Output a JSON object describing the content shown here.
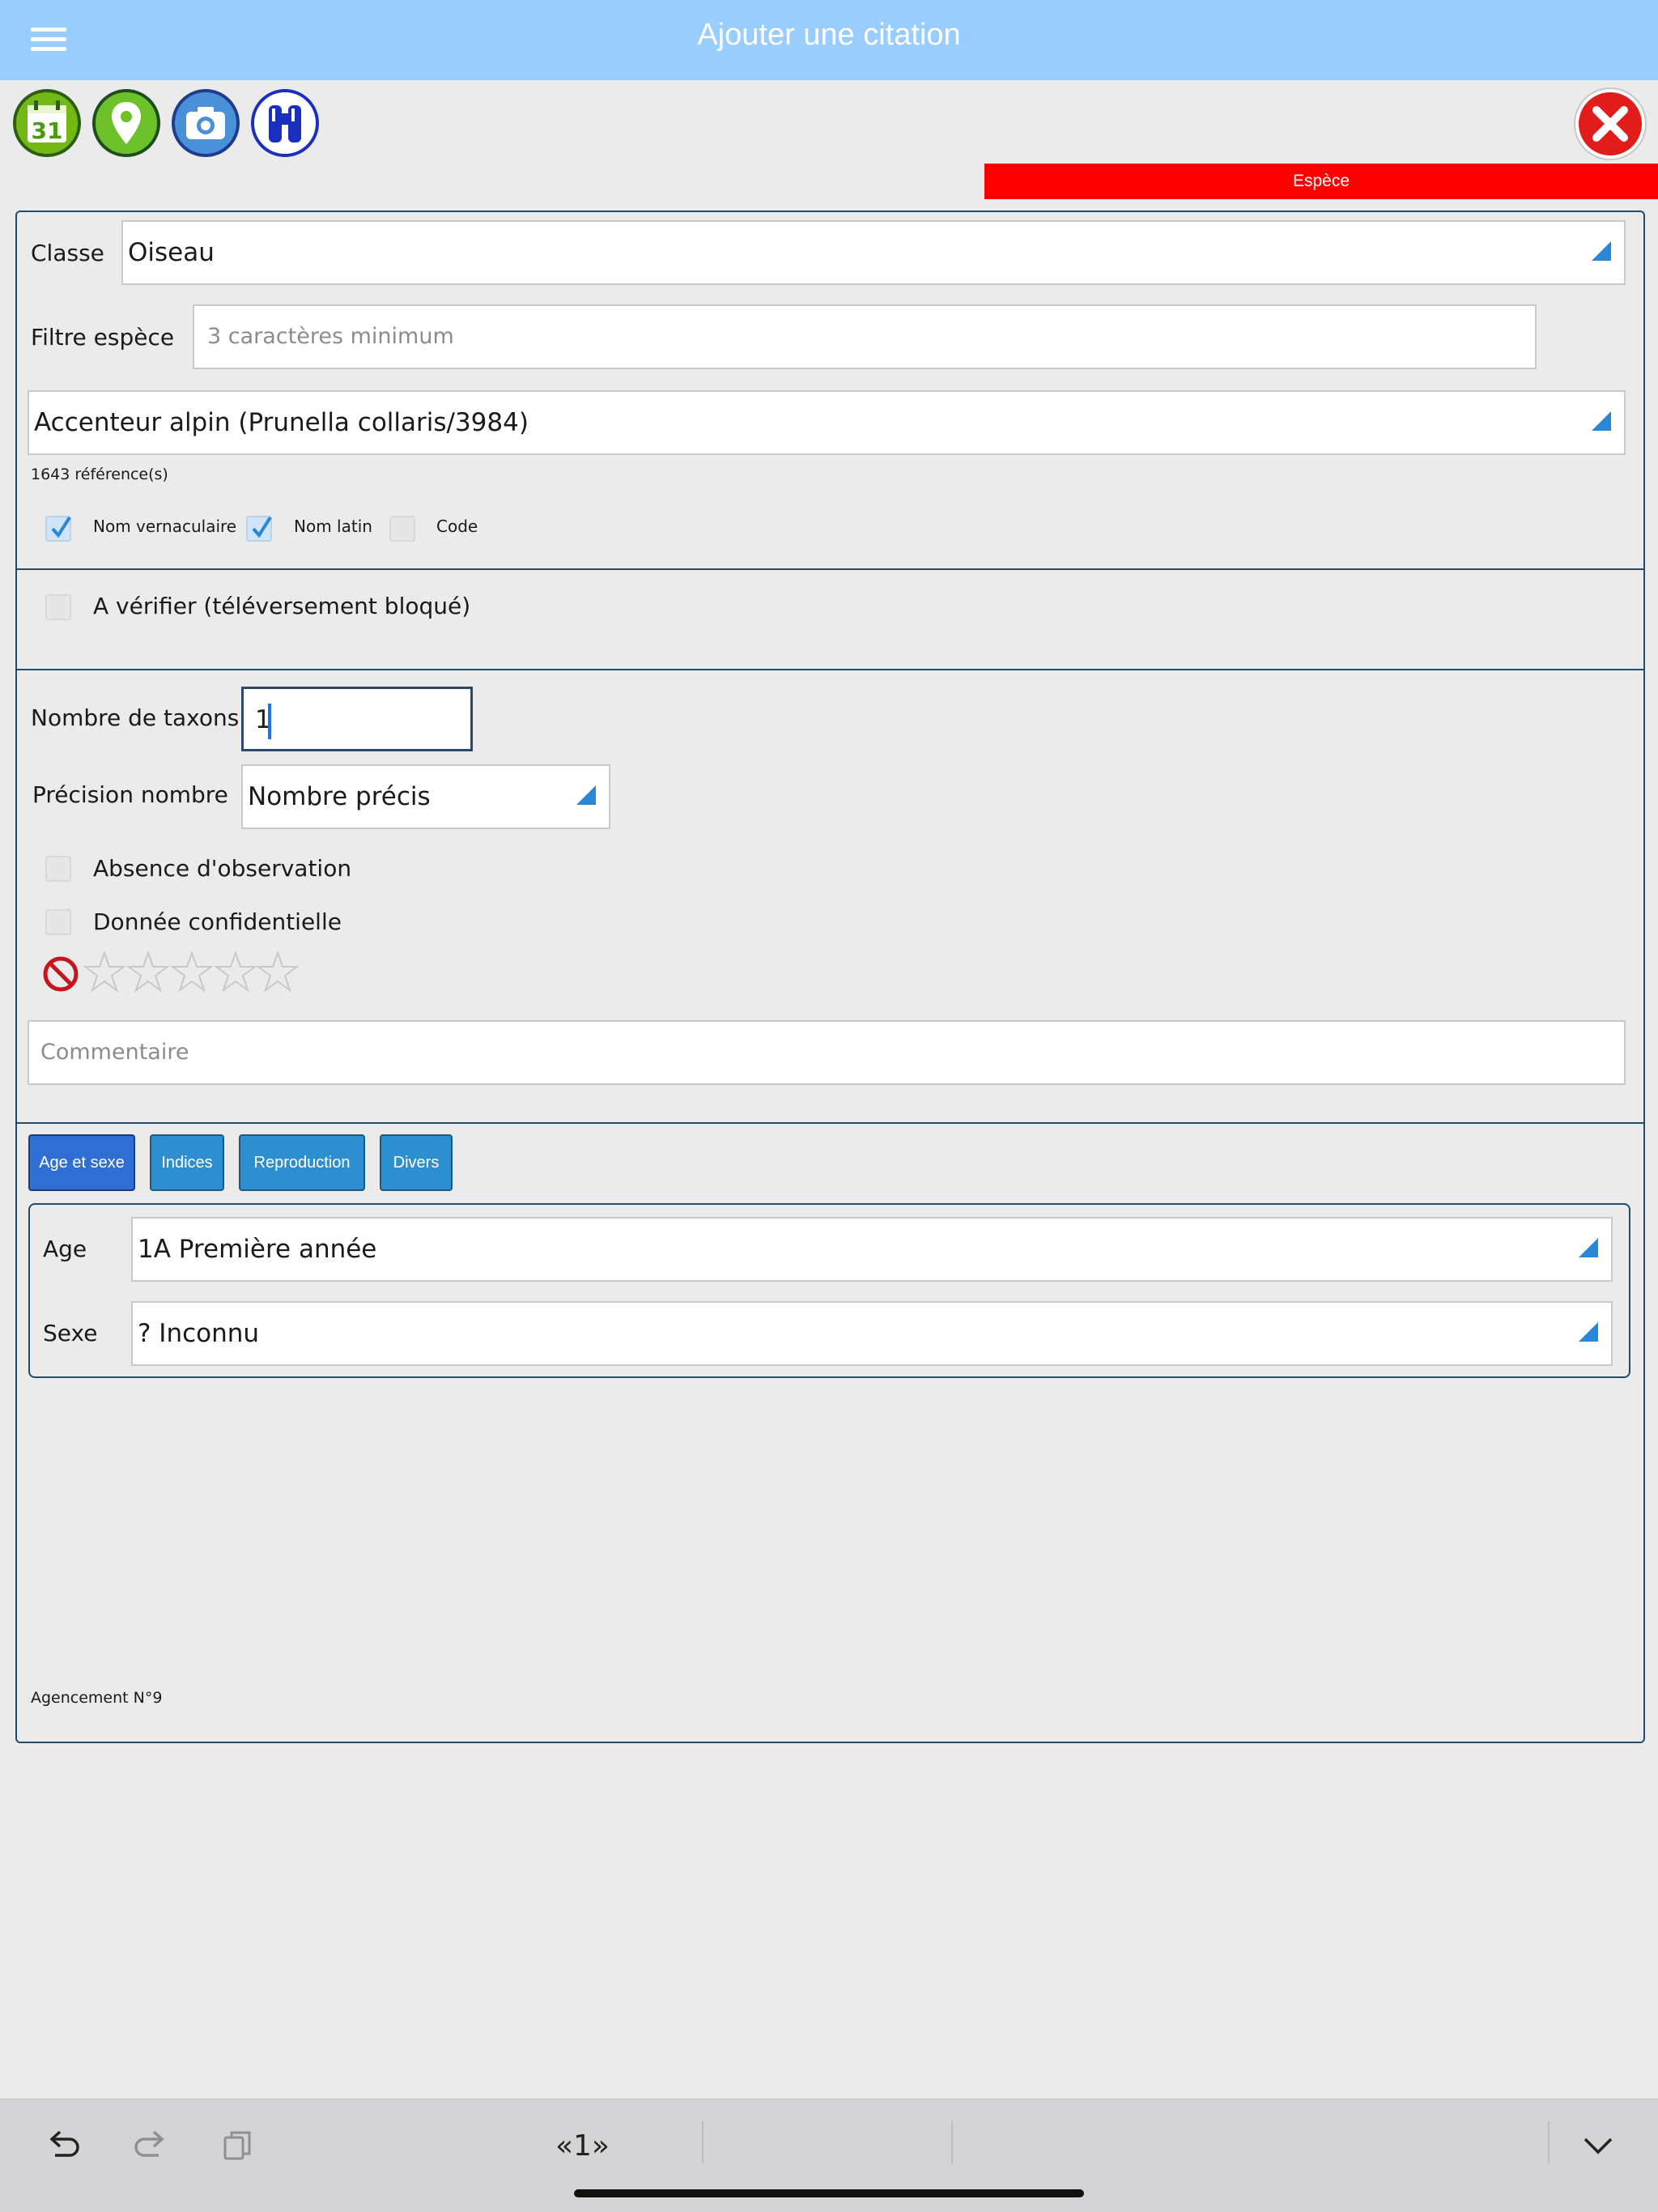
{
  "header": {
    "title": "Ajouter une citation"
  },
  "toolbar": {
    "tools": [
      "calendar-icon",
      "location-pin-icon",
      "camera-icon",
      "binoculars-icon"
    ],
    "calendar_day": "31",
    "close": "close-icon"
  },
  "section_banner": "Espèce",
  "species": {
    "classe_label": "Classe",
    "classe_value": "Oiseau",
    "filter_label": "Filtre espèce",
    "filter_placeholder": "3 caractères minimum",
    "species_value": "Accenteur alpin (Prunella collaris/3984)",
    "references": "1643 référence(s)",
    "opt_vernacular": {
      "label": "Nom vernaculaire",
      "checked": true
    },
    "opt_latin": {
      "label": "Nom latin",
      "checked": true
    },
    "opt_code": {
      "label": "Code",
      "checked": false
    }
  },
  "verify": {
    "label": "A vérifier (téléversement bloqué)",
    "checked": false
  },
  "counts": {
    "taxa_label": "Nombre de taxons",
    "taxa_value": "1",
    "precision_label": "Précision nombre",
    "precision_value": "Nombre précis",
    "absence_label": "Absence d'observation",
    "absence_checked": false,
    "confidential_label": "Donnée confidentielle",
    "confidential_checked": false,
    "rating": 0,
    "rating_max": 5,
    "comment_placeholder": "Commentaire"
  },
  "tabs": [
    {
      "label": "Age et sexe",
      "active": true
    },
    {
      "label": "Indices",
      "active": false
    },
    {
      "label": "Reproduction",
      "active": false
    },
    {
      "label": "Divers",
      "active": false
    }
  ],
  "age_sex": {
    "age_label": "Age",
    "age_value": "1A Première année",
    "sex_label": "Sexe",
    "sex_value": "? Inconnu"
  },
  "footer_note": "Agencement N°9",
  "bottom_bar": {
    "undo": "undo-icon",
    "redo": "redo-icon",
    "paste": "clipboard-icon",
    "page": "«1»",
    "collapse": "chevron-down-icon"
  },
  "colors": {
    "topbar": "#99ccff",
    "banner": "#ff0000",
    "tab": "#2e8fd0",
    "tab_active": "#2f6fd3",
    "panel_border": "#234a6b"
  }
}
